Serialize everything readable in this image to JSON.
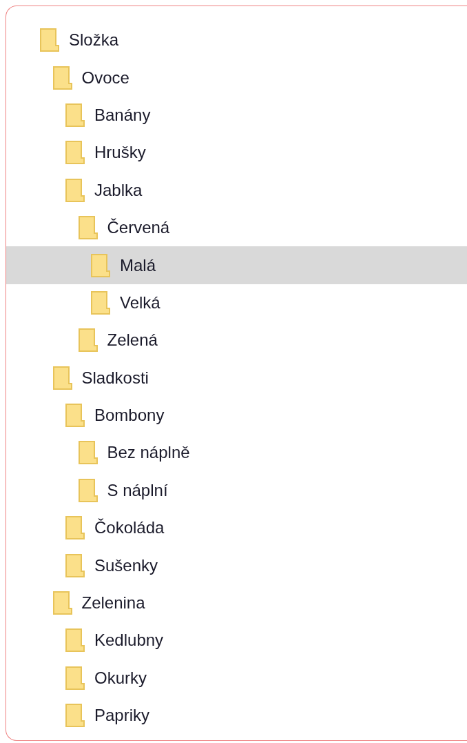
{
  "tree": [
    {
      "label": "Složka",
      "selected": false,
      "children": [
        {
          "label": "Ovoce",
          "selected": false,
          "children": [
            {
              "label": "Banány",
              "selected": false
            },
            {
              "label": "Hrušky",
              "selected": false
            },
            {
              "label": "Jablka",
              "selected": false,
              "children": [
                {
                  "label": "Červená",
                  "selected": false,
                  "children": [
                    {
                      "label": "Malá",
                      "selected": true
                    },
                    {
                      "label": "Velká",
                      "selected": false
                    }
                  ]
                },
                {
                  "label": "Zelená",
                  "selected": false
                }
              ]
            }
          ]
        },
        {
          "label": "Sladkosti",
          "selected": false,
          "children": [
            {
              "label": "Bombony",
              "selected": false,
              "children": [
                {
                  "label": "Bez náplně",
                  "selected": false
                },
                {
                  "label": "S náplní",
                  "selected": false
                }
              ]
            },
            {
              "label": "Čokoláda",
              "selected": false
            },
            {
              "label": "Sušenky",
              "selected": false
            }
          ]
        },
        {
          "label": "Zelenina",
          "selected": false,
          "children": [
            {
              "label": "Kedlubny",
              "selected": false
            },
            {
              "label": "Okurky",
              "selected": false
            },
            {
              "label": "Papriky",
              "selected": false
            }
          ]
        }
      ]
    }
  ]
}
